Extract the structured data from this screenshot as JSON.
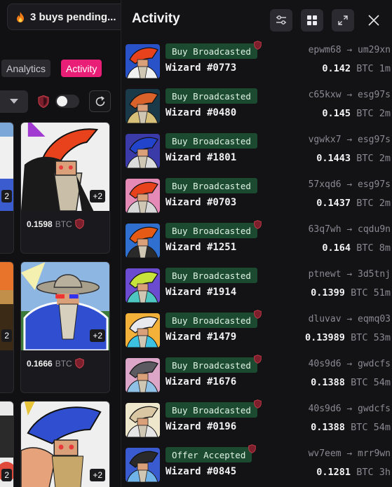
{
  "pending": {
    "text": "3 buys pending..."
  },
  "tabs": {
    "analytics": "Analytics",
    "activity": "Activity"
  },
  "cards": [
    {
      "price": "0.1598",
      "currency": "BTC",
      "plus": "+2"
    },
    {
      "price": "0.1666",
      "currency": "BTC",
      "plus": "+2"
    },
    {
      "price": "",
      "currency": "",
      "plus": "+2"
    }
  ],
  "left_plus": [
    "2",
    "2",
    "2"
  ],
  "panel": {
    "title": "Activity"
  },
  "activity": [
    {
      "badge": "Buy Broadcasted",
      "verified": true,
      "name": "Wizard #0773",
      "from": "epwm68",
      "to": "um29xn",
      "amount": "0.142",
      "currency": "BTC",
      "time": "1m",
      "colors": [
        "#2952c9",
        "#e8421c",
        "#f0f0f0"
      ]
    },
    {
      "badge": "Buy Broadcasted",
      "verified": false,
      "name": "Wizard #0480",
      "from": "c65kxw",
      "to": "esg97s",
      "amount": "0.145",
      "currency": "BTC",
      "time": "2m",
      "colors": [
        "#1a3a4a",
        "#d9622b",
        "#d7c07a"
      ]
    },
    {
      "badge": "Buy Broadcasted",
      "verified": false,
      "name": "Wizard #1801",
      "from": "vgwkx7",
      "to": "esg97s",
      "amount": "0.1443",
      "currency": "BTC",
      "time": "2m",
      "colors": [
        "#3a3aa8",
        "#2244cc",
        "#dcdcdc"
      ]
    },
    {
      "badge": "Buy Broadcasted",
      "verified": false,
      "name": "Wizard #0703",
      "from": "57xqd6",
      "to": "esg97s",
      "amount": "0.1437",
      "currency": "BTC",
      "time": "2m",
      "colors": [
        "#e58ab6",
        "#e8421c",
        "#d7d7d7"
      ]
    },
    {
      "badge": "Buy Broadcasted",
      "verified": true,
      "name": "Wizard #1251",
      "from": "63q7wh",
      "to": "cqdu9n",
      "amount": "0.164",
      "currency": "BTC",
      "time": "8m",
      "colors": [
        "#2f6fd0",
        "#e55b16",
        "#2a2a2a"
      ]
    },
    {
      "badge": "Buy Broadcasted",
      "verified": false,
      "name": "Wizard #1914",
      "from": "ptnewt",
      "to": "3d5tnj",
      "amount": "0.1399",
      "currency": "BTC",
      "time": "51m",
      "colors": [
        "#6b4bd0",
        "#c7e23a",
        "#4ec7c2"
      ]
    },
    {
      "badge": "Buy Broadcasted",
      "verified": true,
      "name": "Wizard #1479",
      "from": "dluvav",
      "to": "eqmq03",
      "amount": "0.13989",
      "currency": "BTC",
      "time": "53m",
      "colors": [
        "#f3b13a",
        "#e8e8ef",
        "#3dc1e0"
      ]
    },
    {
      "badge": "Buy Broadcasted",
      "verified": true,
      "name": "Wizard #1676",
      "from": "40s9d6",
      "to": "gwdcfs",
      "amount": "0.1388",
      "currency": "BTC",
      "time": "54m",
      "colors": [
        "#dca6c8",
        "#5a5a60",
        "#8fc0e6"
      ]
    },
    {
      "badge": "Buy Broadcasted",
      "verified": true,
      "name": "Wizard #0196",
      "from": "40s9d6",
      "to": "gwdcfs",
      "amount": "0.1388",
      "currency": "BTC",
      "time": "54m",
      "colors": [
        "#efe7cc",
        "#d8c7a2",
        "#e5e5e5"
      ]
    },
    {
      "badge": "Offer Accepted",
      "verified": true,
      "name": "Wizard #0845",
      "from": "wv7eem",
      "to": "mrr9wn",
      "amount": "0.1281",
      "currency": "BTC",
      "time": "3h",
      "colors": [
        "#3a5bd0",
        "#2a2a2a",
        "#6fb3e8"
      ]
    }
  ],
  "theme": {
    "accent": "#e91e77",
    "badge_bg": "#1c4a30",
    "verified_red": "#a3263a"
  },
  "icons": [
    "flame-icon",
    "chevron-down-icon",
    "shield-icon",
    "refresh-icon",
    "filter-icon",
    "grid-icon",
    "expand-icon",
    "close-icon"
  ]
}
